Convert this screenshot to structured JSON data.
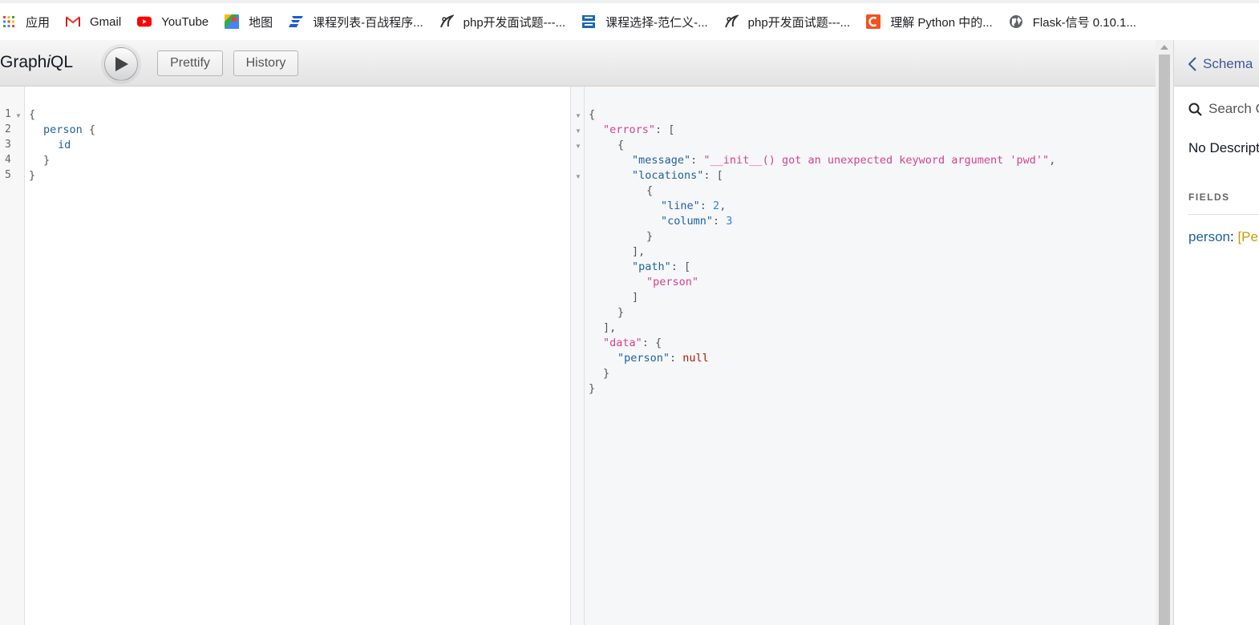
{
  "bookmarks": [
    {
      "label": "应用",
      "icon": "apps-grid-icon"
    },
    {
      "label": "Gmail",
      "icon": "gmail-icon"
    },
    {
      "label": "YouTube",
      "icon": "youtube-icon"
    },
    {
      "label": "地图",
      "icon": "maps-icon"
    },
    {
      "label": "课程列表-百战程序...",
      "icon": "baizhan-icon"
    },
    {
      "label": "php开发面试题---...",
      "icon": "php-bird-icon"
    },
    {
      "label": "课程选择-范仁义-...",
      "icon": "biancheng-icon"
    },
    {
      "label": "php开发面试题---...",
      "icon": "php-bird-icon"
    },
    {
      "label": "理解 Python 中的...",
      "icon": "c-logo-icon"
    },
    {
      "label": "Flask-信号 0.10.1...",
      "icon": "globe-icon"
    }
  ],
  "toolbar": {
    "title_prefix": "Graph",
    "title_italic": "i",
    "title_suffix": "QL",
    "prettify_label": "Prettify",
    "history_label": "History"
  },
  "query_editor": {
    "line_numbers": [
      "1",
      "2",
      "3",
      "4",
      "5"
    ],
    "lines": {
      "l1": "{",
      "l2_field": "person",
      "l2_brace": " {",
      "l3_field": "id",
      "l4": "}",
      "l5": "}"
    }
  },
  "result": {
    "message_key": "\"message\"",
    "message_value": "\"__init__() got an unexpected keyword argument 'pwd'\"",
    "errors_key": "\"errors\"",
    "locations_key": "\"locations\"",
    "line_key": "\"line\"",
    "line_value": "2",
    "column_key": "\"column\"",
    "column_value": "3",
    "path_key": "\"path\"",
    "path_value": "\"person\"",
    "data_key": "\"data\"",
    "person_key": "\"person\"",
    "person_value": "null"
  },
  "docs": {
    "back_label": "Schema",
    "search_placeholder": "Search Q",
    "description": "No Description",
    "fields_title": "FIELDS",
    "field_name": "person",
    "field_sep": ": ",
    "field_type": "[Person]"
  },
  "colors": {
    "string": "#d64292",
    "number": "#2882f9",
    "keyword": "#b11a04",
    "property": "#1f61a0",
    "type": "#ca9800",
    "link": "#3b5998"
  }
}
